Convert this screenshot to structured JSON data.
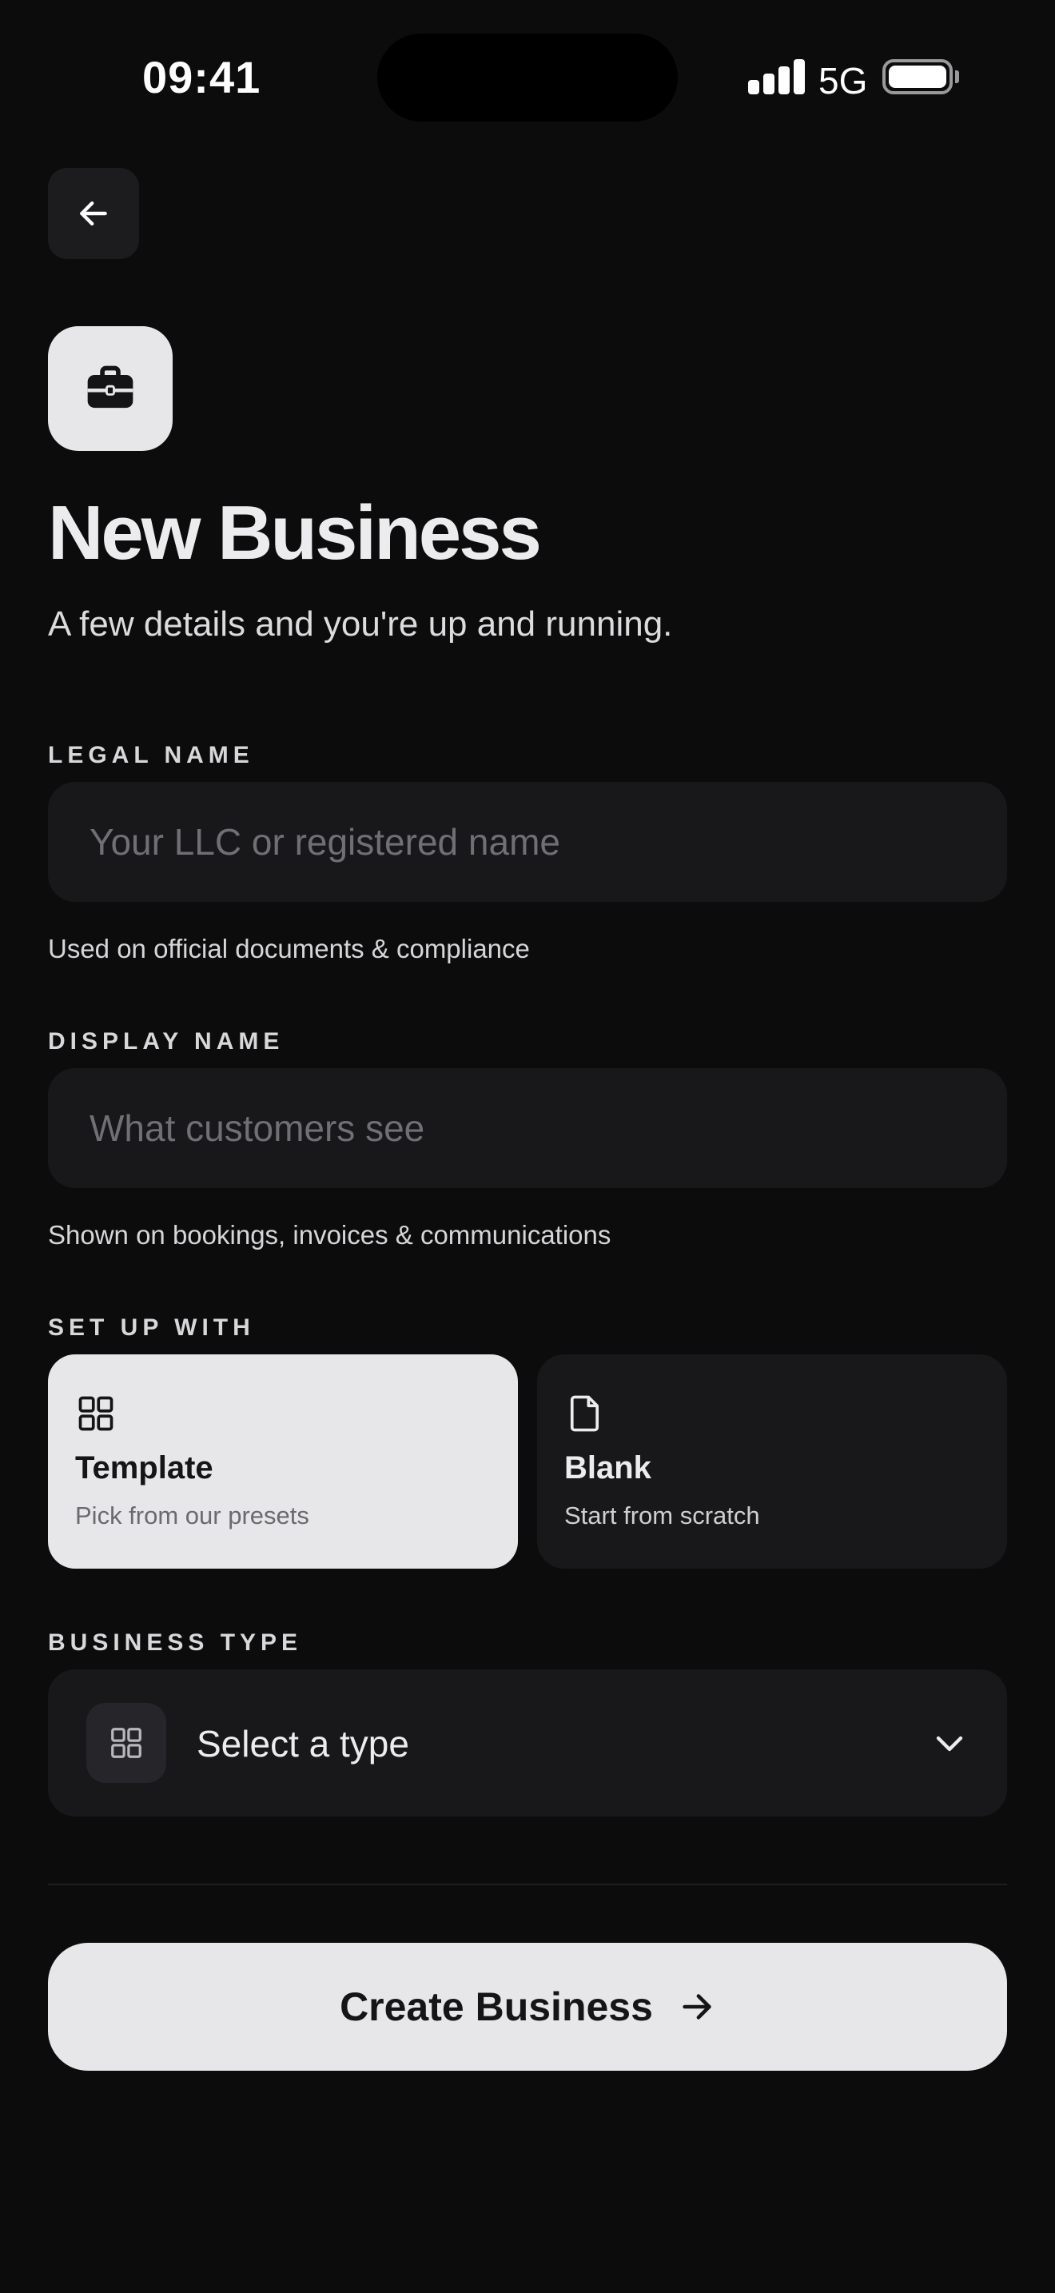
{
  "status_bar": {
    "time": "09:41",
    "network": "5G",
    "icons": [
      "signal-icon",
      "battery-icon"
    ]
  },
  "navigation": {
    "back_icon": "arrow-left-icon"
  },
  "header": {
    "icon": "briefcase-icon",
    "title": "New Business",
    "subtitle": "A few details and you're up and running."
  },
  "form": {
    "legal_name": {
      "label": "LEGAL NAME",
      "value": "",
      "placeholder": "Your LLC or registered name",
      "helper": "Used on official documents & compliance"
    },
    "display_name": {
      "label": "DISPLAY NAME",
      "value": "",
      "placeholder": "What customers see",
      "helper": "Shown on bookings, invoices & communications"
    },
    "setup": {
      "label": "SET UP WITH",
      "options": [
        {
          "icon": "grid-icon",
          "title": "Template",
          "description": "Pick from our presets",
          "selected": true
        },
        {
          "icon": "document-icon",
          "title": "Blank",
          "description": "Start from scratch",
          "selected": false
        }
      ]
    },
    "business_type": {
      "label": "BUSINESS TYPE",
      "icon": "grid-icon",
      "value": "Select a type",
      "chevron": "chevron-down-icon"
    }
  },
  "actions": {
    "create_label": "Create Business",
    "create_icon": "arrow-right-icon"
  },
  "colors": {
    "background": "#0c0c0d",
    "surface": "#18181b",
    "light_surface": "#e7e7e9",
    "text_primary": "#ececee",
    "text_dark": "#151517",
    "placeholder": "#6f6f74"
  }
}
